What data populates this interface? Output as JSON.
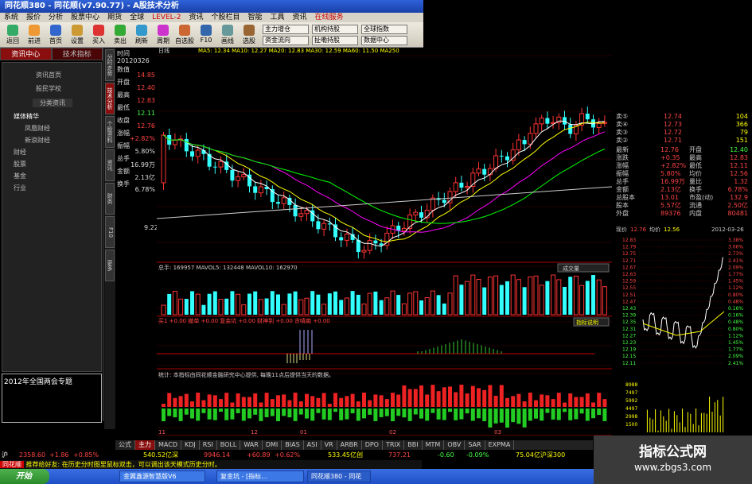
{
  "window_title": "同花顺380 - 同花顺(v7.90.77) - A股技术分析",
  "menu": [
    "系统",
    "报价",
    "分析",
    "股票中心",
    "期货",
    "全球",
    "LEVEL-2",
    "资讯",
    "个股栏目",
    "智能",
    "工具",
    "资讯",
    "在线服务"
  ],
  "toolbar": {
    "buttons": [
      "返回",
      "前进",
      "首页",
      "设置",
      "买入",
      "卖出",
      "刷新",
      "周期",
      "自选股",
      "F10",
      "画线",
      "选股"
    ],
    "dropdowns": [
      "主力增仓",
      "机构持股",
      "全球指数",
      "资金流向",
      "扯嘞持股",
      "数据中心"
    ]
  },
  "left": {
    "tabs": [
      "资讯中心",
      "技术指标"
    ],
    "items": [
      "资讯首页",
      "股民学校",
      "分类资讯",
      "媒体精华",
      "凤凰财经",
      "新浪财经",
      "财经",
      "股票",
      "基金",
      "行业"
    ],
    "promo": "2012年全国两会专题"
  },
  "vtabs": [
    "分时走势",
    "技术分析",
    "个股资料",
    "资讯",
    "财务",
    "F10",
    "更多"
  ],
  "info": {
    "date_label": "时间",
    "date": "20120326",
    "labels": [
      "数值",
      "开盘",
      "最高",
      "最低",
      "收盘",
      "涨幅",
      "振幅",
      "总手",
      "金额",
      "换手"
    ],
    "values": [
      "14.85",
      "12.40",
      "12.83",
      "12.11",
      "12.76",
      "+2.82%",
      "5.80%",
      "16.99万",
      "2.13亿",
      "6.78%"
    ],
    "low_price": "9.22"
  },
  "chart_header": {
    "title": "日线",
    "ma": "MA5: 12.34 MA10: 12.27 MA20: 12.83 MA30: 12.59 MA60: 11.50 MA250"
  },
  "vol_header": "总手: 169957 MAVOL5: 132448 MAVOL10: 162970",
  "vol_dropdown": "成交量",
  "vol_levels": [
    "338141",
    "171108"
  ],
  "ind_header": "买1 +0.00 撤单 +0.00 复金坑 +0.00 财神到 +0.00 贪嗔痴 +0.00",
  "ind_button": "指标说明",
  "ind_levels": [
    "+40.00",
    "+11.00"
  ],
  "flow_header": "统计: 本指标由同花顺金融研究中心提供, 每晚11点后提供当天的数据。",
  "flow_levels": [
    "123668",
    "1075"
  ],
  "x_ticks": [
    "11",
    "12",
    "01",
    "02",
    "03"
  ],
  "orderbook": {
    "sell": [
      [
        "卖⑤",
        "12.74",
        "104"
      ],
      [
        "卖④",
        "12.73",
        "366"
      ],
      [
        "卖③",
        "12.72",
        "79"
      ],
      [
        "卖②",
        "12.71",
        "151"
      ]
    ],
    "stats": [
      [
        "最新",
        "12.76",
        "开盘",
        "12.40"
      ],
      [
        "涨跌",
        "+0.35",
        "最高",
        "12.83"
      ],
      [
        "涨幅",
        "+2.82%",
        "最低",
        "12.11"
      ],
      [
        "振幅",
        "5.80%",
        "均价",
        "12.56"
      ],
      [
        "总手",
        "16.99万",
        "量比",
        "1.32"
      ],
      [
        "金额",
        "2.13亿",
        "换手",
        "6.78%"
      ],
      [
        "总股本",
        "13.01",
        "市盈(动)",
        "132.9"
      ],
      [
        "股本",
        "5.57亿",
        "流通",
        "2.50亿"
      ],
      [
        "外盘",
        "89376",
        "内盘",
        "80481"
      ]
    ]
  },
  "mini": {
    "label": "现价",
    "price": "12.76",
    "avg_label": "均价",
    "avg": "12.56",
    "date": "2012-03-26",
    "prices": [
      "12.83",
      "12.79",
      "12.75",
      "12.71",
      "12.67",
      "12.63",
      "12.59",
      "12.55",
      "12.51",
      "12.47",
      "12.43",
      "12.39",
      "12.35",
      "12.31",
      "12.27",
      "12.23",
      "12.19",
      "12.15",
      "12.11"
    ],
    "pcts": [
      "3.38%",
      "3.06%",
      "2.73%",
      "2.41%",
      "2.09%",
      "1.77%",
      "1.45%",
      "1.12%",
      "0.80%",
      "0.48%",
      "0.16%",
      "0.16%",
      "0.48%",
      "0.80%",
      "1.12%",
      "1.45%",
      "1.77%",
      "2.09%",
      "2.41%"
    ],
    "vols": [
      "8988",
      "7497",
      "5992",
      "4497",
      "2998",
      "1500"
    ]
  },
  "bottom_tabs": [
    "公式",
    "主力",
    "MACD",
    "KDJ",
    "RSI",
    "BOLL",
    "WAR",
    "DMI",
    "BIAS",
    "ASI",
    "VR",
    "ARBR",
    "DPO",
    "TRIX",
    "BBI",
    "MTM",
    "OBV",
    "SAR",
    "EXPMA"
  ],
  "index_bar": {
    "sh": "沪",
    "sh_val": "2358.60",
    "sh_chg": "+1.86",
    "sh_pct": "+0.85%",
    "amt1": "540.52亿深",
    "val2": "9946.14",
    "chg2": "+60.89",
    "pct2": "+0.62%",
    "amt2": "533.45亿创",
    "val3": "737.21",
    "chg3": "-0.60",
    "pct3": "-0.09%",
    "amt3": "75.04亿沪深300"
  },
  "news": "推荐给好友: 在历史分时图里鼠标双击，可以调出该天模式历史分时。",
  "taskbar": {
    "start": "开始",
    "tasks": [
      "金翼鑫源智慧版V6",
      "复金坑 - [指标...",
      "同花顺380 - 同花"
    ]
  },
  "watermark": {
    "line1": "指标公式网",
    "line2": "www.zbgs3.com"
  },
  "colors": {
    "up": "#ff3333",
    "down": "#33ffff",
    "ma5": "#ffffff",
    "ma10": "#ffff00",
    "ma20": "#ff00ff",
    "ma30": "#00ff00"
  }
}
